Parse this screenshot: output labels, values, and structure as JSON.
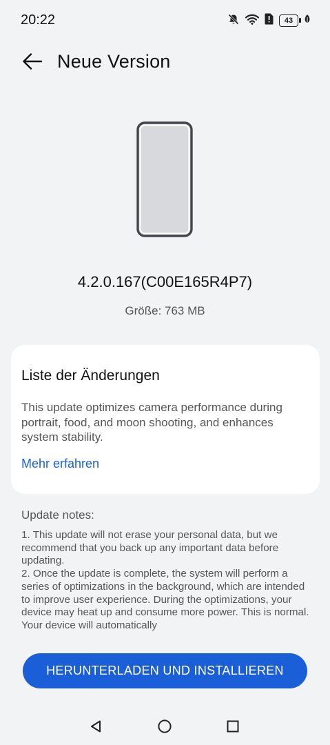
{
  "status_bar": {
    "time": "20:22",
    "battery_level": "43",
    "icons": [
      "bell-muted-icon",
      "wifi-icon",
      "sim-alert-icon",
      "battery-icon",
      "leaf-icon"
    ]
  },
  "header": {
    "back_icon": "arrow-left-icon",
    "title": "Neue Version"
  },
  "update": {
    "device_icon": "phone-outline-icon",
    "version": "4.2.0.167(C00E165R4P7)",
    "size": "Größe: 763 MB"
  },
  "changes": {
    "title": "Liste der Änderungen",
    "body": "This update optimizes camera performance during portrait, food, and moon shooting, and enhances system stability.",
    "more_label": "Mehr erfahren"
  },
  "notes": {
    "title": "Update notes:",
    "items": [
      "1. This update will not erase your personal data, but we recommend that you back up any important data before updating.",
      "2. Once the update is complete, the system will perform a series of optimizations in the background, which are intended to improve user experience. During the optimizations, your device may heat up and consume more power. This is normal. Your device will automatically"
    ]
  },
  "actions": {
    "download_install_label": "HERUNTERLADEN UND INSTALLIEREN"
  },
  "nav_bar": {
    "icons": [
      "back-triangle-icon",
      "home-circle-icon",
      "recents-square-icon"
    ]
  },
  "colors": {
    "background": "#f1f3f5",
    "card": "#ffffff",
    "accent": "#1a5fd8",
    "secondary_text": "#555555"
  }
}
